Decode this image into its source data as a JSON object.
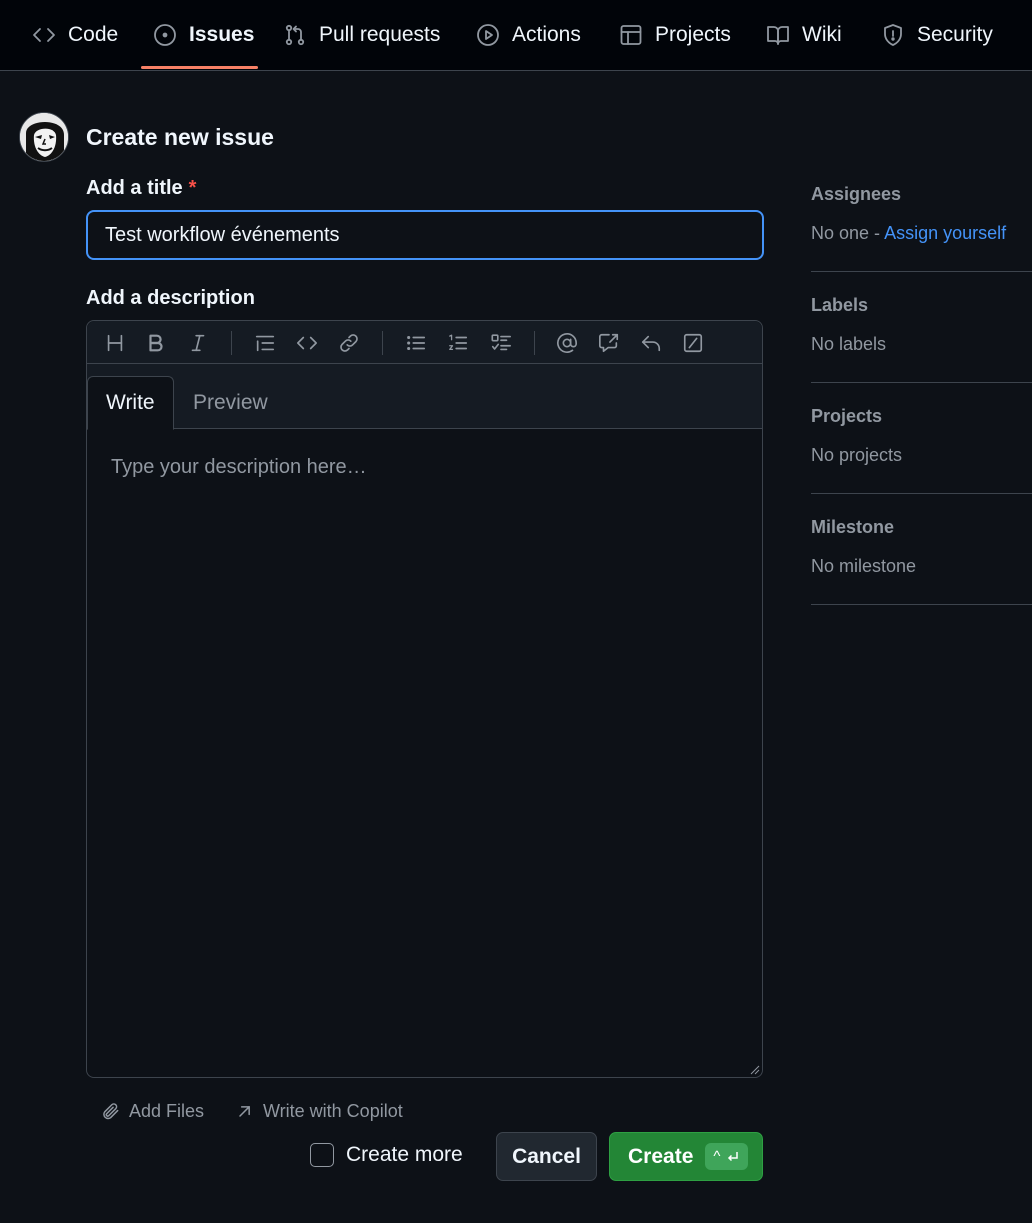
{
  "nav": {
    "items": [
      {
        "label": "Code",
        "icon": "code-icon"
      },
      {
        "label": "Issues",
        "icon": "issue-opened-icon"
      },
      {
        "label": "Pull requests",
        "icon": "git-pull-request-icon"
      },
      {
        "label": "Actions",
        "icon": "play-icon"
      },
      {
        "label": "Projects",
        "icon": "table-icon"
      },
      {
        "label": "Wiki",
        "icon": "book-icon"
      },
      {
        "label": "Security",
        "icon": "shield-icon"
      }
    ],
    "active": "Issues"
  },
  "page": {
    "title": "Create new issue"
  },
  "form": {
    "title_label": "Add a title",
    "required_mark": "*",
    "title_value": "Test workflow événements",
    "description_label": "Add a description",
    "tabs": {
      "write": "Write",
      "preview": "Preview"
    },
    "description_placeholder": "Type your description here…",
    "toolbar": [
      "heading-icon",
      "bold-icon",
      "italic-icon",
      "quote-icon",
      "code-icon",
      "link-icon",
      "unordered-list-icon",
      "ordered-list-icon",
      "tasklist-icon",
      "mention-icon",
      "cross-reference-icon",
      "reply-icon",
      "slash-command-icon"
    ]
  },
  "footer": {
    "add_files": "Add Files",
    "write_with_copilot": "Write with Copilot",
    "create_more": "Create more",
    "cancel": "Cancel",
    "create": "Create",
    "create_shortcut": "^"
  },
  "sidebar": {
    "assignees": {
      "heading": "Assignees",
      "value": "No one -",
      "link": "Assign yourself"
    },
    "labels": {
      "heading": "Labels",
      "value": "No labels"
    },
    "projects": {
      "heading": "Projects",
      "value": "No projects"
    },
    "milestone": {
      "heading": "Milestone",
      "value": "No milestone"
    }
  },
  "colors": {
    "background": "#0d1117",
    "accent_blue": "#4493f8",
    "create_green": "#238636",
    "active_tab_underline": "#f78166",
    "required_red": "#f85149"
  }
}
